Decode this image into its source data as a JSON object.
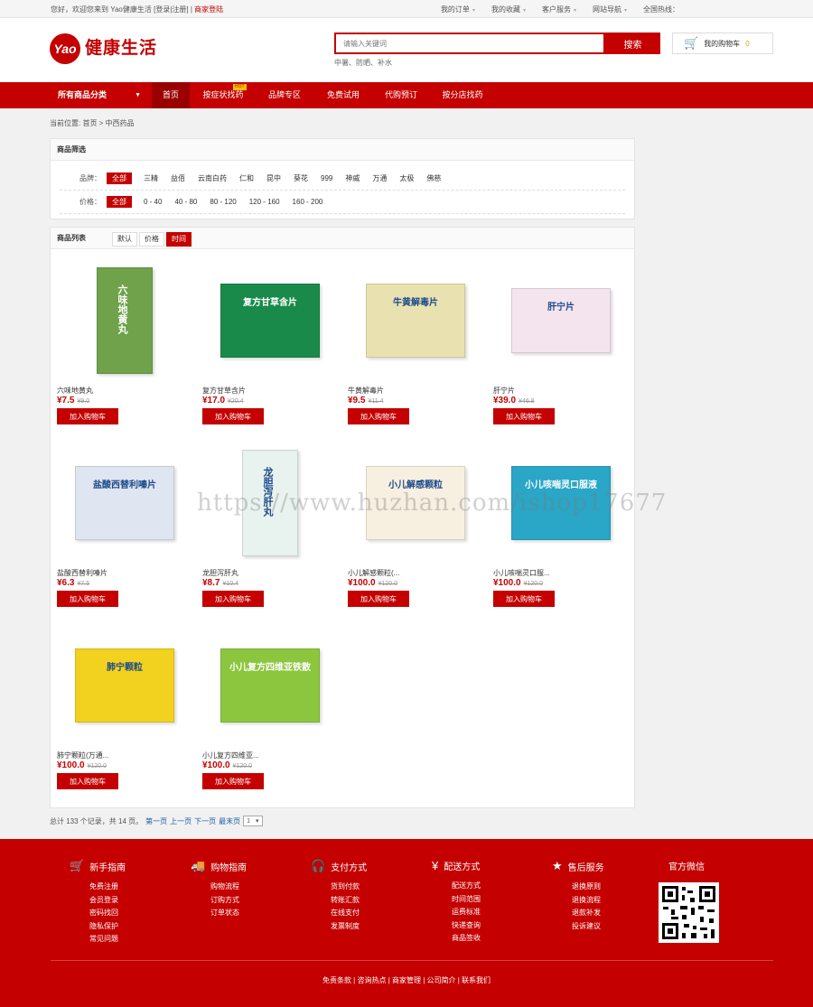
{
  "topbar": {
    "welcome": "您好，欢迎您来到 Yao健康生活 [",
    "login": "登录",
    "sep1": "|",
    "register": "注册",
    "sep2": "] |",
    "merchant": "商家登陆",
    "links": [
      "我的订单",
      "我的收藏",
      "客户服务",
      "网站导航"
    ],
    "hotline": "全国热线："
  },
  "header": {
    "logo_text": "Yao",
    "brand_text": "健康生活",
    "search_placeholder": "请输入关键词",
    "search_button": "搜索",
    "hot_words": "中暑、防晒、补水",
    "cart_label": "我的购物车",
    "cart_count": "0"
  },
  "nav": {
    "category": "所有商品分类",
    "items": [
      "首页",
      "按症状找药",
      "品牌专区",
      "免费试用",
      "代购预订",
      "按分店找药"
    ],
    "hot_badge": "HOT"
  },
  "breadcrumb": "当前位置: 首页 > 中西药品",
  "filter": {
    "title": "商品筛选",
    "brand_label": "品牌：",
    "brands": [
      "全部",
      "三精",
      "益佰",
      "云南白药",
      "仁和",
      "昆中",
      "葵花",
      "999",
      "神威",
      "万通",
      "太极",
      "佛慈"
    ],
    "price_label": "价格：",
    "prices": [
      "全部",
      "0 - 40",
      "40 - 80",
      "80 - 120",
      "120 - 160",
      "160 - 200"
    ]
  },
  "list": {
    "title": "商品列表",
    "sort": [
      "默认",
      "价格",
      "时间"
    ],
    "add_to_cart": "加入购物车",
    "products": [
      {
        "name": "六味地黄丸",
        "price": "¥7.5",
        "old": "¥9.0",
        "box_text": "六味地黄丸",
        "color": "#6fa24a"
      },
      {
        "name": "复方甘草含片",
        "price": "¥17.0",
        "old": "¥20.4",
        "box_text": "复方甘草含片",
        "color": "#1a8a4a"
      },
      {
        "name": "牛黄解毒片",
        "price": "¥9.5",
        "old": "¥11.4",
        "box_text": "牛黄解毒片",
        "color": "#e9e2b0"
      },
      {
        "name": "肝宁片",
        "price": "¥39.0",
        "old": "¥46.8",
        "box_text": "肝宁片",
        "color": "#f4e4ee"
      },
      {
        "name": "盐酸西替利嗪片",
        "price": "¥6.3",
        "old": "¥7.5",
        "box_text": "盐酸西替利嗪片",
        "color": "#dfe6f2"
      },
      {
        "name": "龙胆泻肝丸",
        "price": "¥8.7",
        "old": "¥10.4",
        "box_text": "龙胆泻肝丸",
        "color": "#e8f2ee"
      },
      {
        "name": "小儿解感颗粒(...",
        "price": "¥100.0",
        "old": "¥120.0",
        "box_text": "小儿解感颗粒",
        "color": "#f7efe0"
      },
      {
        "name": "小儿咳喘灵口服...",
        "price": "¥100.0",
        "old": "¥120.0",
        "box_text": "小儿咳喘灵口服液",
        "color": "#2aa6c7"
      },
      {
        "name": "肺宁颗粒(万通...",
        "price": "¥100.0",
        "old": "¥120.0",
        "box_text": "肺宁颗粒",
        "color": "#f2d21e"
      },
      {
        "name": "小儿复方四维亚...",
        "price": "¥100.0",
        "old": "¥120.0",
        "box_text": "小儿复方四维亚铁散",
        "color": "#8cc63f"
      }
    ]
  },
  "pager": {
    "summary": "总计 133 个记录，共 14 页。",
    "first": "第一页",
    "prev": "上一页",
    "next": "下一页",
    "last": "最末页",
    "current": "1"
  },
  "watermark": "https://www.huzhan.com/ishop17677",
  "footer": {
    "columns": [
      {
        "title": "新手指南",
        "icon": "cart-icon",
        "links": [
          "免费注册",
          "会员登录",
          "密码找回",
          "隐私保护",
          "常见问题"
        ]
      },
      {
        "title": "购物指南",
        "icon": "truck-icon",
        "links": [
          "购物流程",
          "订购方式",
          "订单状态"
        ]
      },
      {
        "title": "支付方式",
        "icon": "headset-icon",
        "links": [
          "货到付款",
          "转账汇款",
          "在线支付",
          "发票制度"
        ]
      },
      {
        "title": "配送方式",
        "icon": "yen-icon",
        "links": [
          "配送方式",
          "时间范围",
          "运费标准",
          "快递查询",
          "商品签收"
        ]
      },
      {
        "title": "售后服务",
        "icon": "star-icon",
        "links": [
          "退换原则",
          "退换流程",
          "退款补发",
          "投诉建议"
        ]
      }
    ],
    "wechat_title": "官方微信",
    "bottom_links": "免责条款 | 咨询热点 | 商家管理 | 公司简介 | 联系我们"
  }
}
